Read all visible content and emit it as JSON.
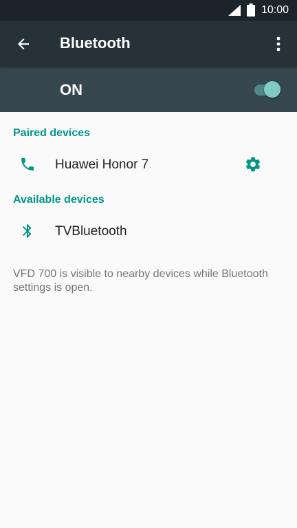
{
  "status_bar": {
    "time": "10:00",
    "signal_icon": "cellular-signal-icon",
    "battery_icon": "battery-full-icon"
  },
  "app_bar": {
    "back_icon": "arrow-back-icon",
    "title": "Bluetooth",
    "overflow_icon": "more-vert-icon",
    "background": "#263238"
  },
  "switch_bar": {
    "label": "ON",
    "toggle_on": true,
    "background": "#37474f",
    "thumb_color": "#80cbc4"
  },
  "paired": {
    "header": "Paired devices",
    "devices": [
      {
        "name": "Huawei Honor 7",
        "icon": "phone-icon",
        "settings_icon": "gear-icon"
      }
    ]
  },
  "available": {
    "header": "Available devices",
    "devices": [
      {
        "name": "TVBluetooth",
        "icon": "bluetooth-icon"
      }
    ]
  },
  "footer": {
    "text": "VFD 700 is visible to nearby devices while Bluetooth settings is open."
  },
  "colors": {
    "accent": "#009688",
    "primary_text": "#212121",
    "secondary_text": "#757575",
    "background": "#fafafa"
  }
}
